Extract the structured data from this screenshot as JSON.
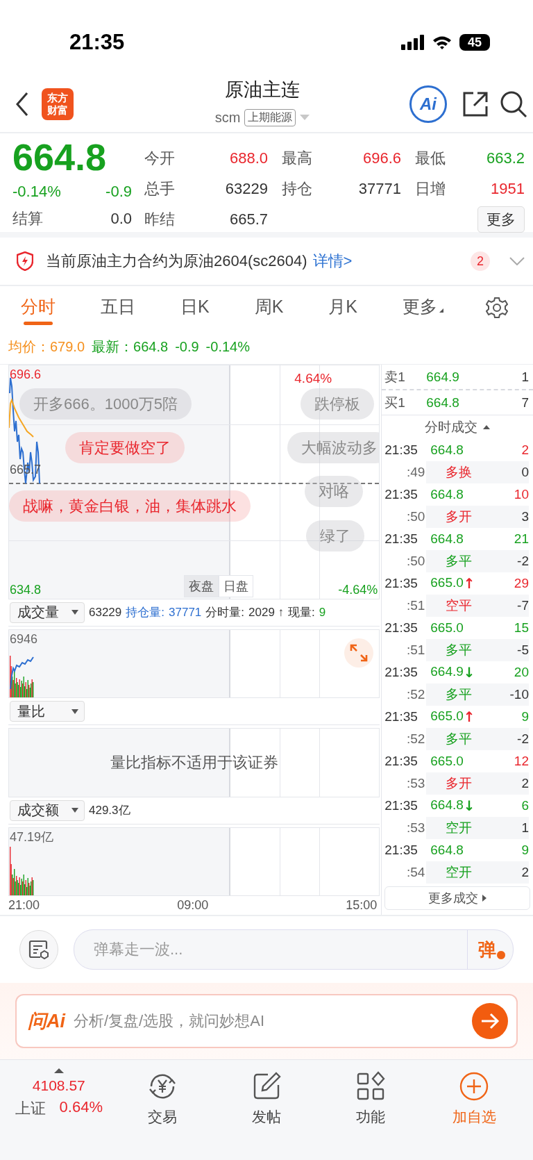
{
  "status_bar": {
    "time": "21:35",
    "battery": "45"
  },
  "header": {
    "logo": [
      "东方",
      "财富"
    ],
    "title": "原油主连",
    "code": "scm",
    "exchange": "上期能源",
    "ai_label": "Ai"
  },
  "quote": {
    "price": "664.8",
    "change_pct": "-0.14%",
    "change": "-0.9",
    "settle_label": "结算",
    "settle_value": "0.0",
    "more_button": "更多",
    "fields": [
      {
        "label": "今开",
        "value": "688.0",
        "color": "#e9262d"
      },
      {
        "label": "最高",
        "value": "696.6",
        "color": "#e9262d"
      },
      {
        "label": "最低",
        "value": "663.2",
        "color": "#17a11f"
      },
      {
        "label": "总手",
        "value": "63229",
        "color": "#333333"
      },
      {
        "label": "持仓",
        "value": "37771",
        "color": "#333333"
      },
      {
        "label": "日增",
        "value": "1951",
        "color": "#e9262d"
      },
      {
        "label": "昨结",
        "value": "665.7",
        "color": "#333333"
      }
    ]
  },
  "notice": {
    "text": "当前原油主力合约为原油2604(sc2604)",
    "link": "详情>",
    "badge": "2"
  },
  "tabs": [
    {
      "label": "分时",
      "selected": true,
      "kind": "tab"
    },
    {
      "label": "五日",
      "selected": false,
      "kind": "tab"
    },
    {
      "label": "日K",
      "selected": false,
      "kind": "tab"
    },
    {
      "label": "周K",
      "selected": false,
      "kind": "tab"
    },
    {
      "label": "月K",
      "selected": false,
      "kind": "tab"
    },
    {
      "label": "更多",
      "selected": false,
      "kind": "menu"
    }
  ],
  "price_summary": {
    "avg_label": "均价：",
    "avg_value": "679.0",
    "last_label": "最新：",
    "last_value": "664.8",
    "change": "-0.9",
    "change_pct": "-0.14%"
  },
  "main_chart": {
    "high": "696.6",
    "high_pct": "4.64%",
    "prev_settle": "665.7",
    "low": "634.8",
    "low_pct": "-4.64%",
    "sessions": [
      {
        "label": "夜盘",
        "selected": true
      },
      {
        "label": "日盘",
        "selected": false
      }
    ],
    "danmaku": [
      {
        "text": "开多666。1000万5陪",
        "kind": "normal"
      },
      {
        "text": "跌停板",
        "kind": "normal"
      },
      {
        "text": "肯定要做空了",
        "kind": "hot"
      },
      {
        "text": "大幅波动多",
        "kind": "normal"
      },
      {
        "text": "战嘛，黄金白银，油，集体跳水",
        "kind": "hot"
      },
      {
        "text": "对咯",
        "kind": "normal"
      },
      {
        "text": "绿了",
        "kind": "normal"
      }
    ]
  },
  "volume_panel": {
    "selector": "成交量",
    "total": "63229",
    "oi_label": "持仓量:",
    "oi_value": "37771",
    "period_label": "分时量:",
    "period_value": "2029 ↑",
    "now_label": "现量:",
    "now_value": "9",
    "axis_max": "6946"
  },
  "ratio_panel": {
    "selector": "量比",
    "message": "量比指标不适用于该证券"
  },
  "amount_panel": {
    "selector": "成交额",
    "total": "429.3亿",
    "axis_max": "47.19亿"
  },
  "time_axis": [
    "21:00",
    "09:00",
    "15:00"
  ],
  "order_book": [
    {
      "label": "卖1",
      "price": "664.9",
      "volume": "1"
    },
    {
      "label": "买1",
      "price": "664.8",
      "volume": "7"
    }
  ],
  "trades_title": "分时成交",
  "trades": [
    {
      "time": "21:35",
      "price": "664.8",
      "volume": {
        "text": "2",
        "color": "#e9262d"
      },
      "second": ":49",
      "type": {
        "text": "多换",
        "color": "#e9262d"
      },
      "change": "0"
    },
    {
      "time": "21:35",
      "price": "664.8",
      "volume": {
        "text": "10",
        "color": "#e9262d"
      },
      "second": ":50",
      "type": {
        "text": "多开",
        "color": "#e9262d"
      },
      "change": "3"
    },
    {
      "time": "21:35",
      "price": "664.8",
      "volume": {
        "text": "21",
        "color": "#17a11f"
      },
      "second": ":50",
      "type": {
        "text": "多平",
        "color": "#17a11f"
      },
      "change": "-2"
    },
    {
      "time": "21:35",
      "price": "665.0",
      "arrow": {
        "text": "↑",
        "color": "#e9262d"
      },
      "volume": {
        "text": "29",
        "color": "#e9262d"
      },
      "second": ":51",
      "type": {
        "text": "空平",
        "color": "#e9262d"
      },
      "change": "-7"
    },
    {
      "time": "21:35",
      "price": "665.0",
      "volume": {
        "text": "15",
        "color": "#17a11f"
      },
      "second": ":51",
      "type": {
        "text": "多平",
        "color": "#17a11f"
      },
      "change": "-5"
    },
    {
      "time": "21:35",
      "price": "664.9",
      "arrow": {
        "text": "↓",
        "color": "#17a11f"
      },
      "volume": {
        "text": "20",
        "color": "#17a11f"
      },
      "second": ":52",
      "type": {
        "text": "多平",
        "color": "#17a11f"
      },
      "change": "-10"
    },
    {
      "time": "21:35",
      "price": "665.0",
      "arrow": {
        "text": "↑",
        "color": "#e9262d"
      },
      "volume": {
        "text": "9",
        "color": "#17a11f"
      },
      "second": ":52",
      "type": {
        "text": "多平",
        "color": "#17a11f"
      },
      "change": "-2"
    },
    {
      "time": "21:35",
      "price": "665.0",
      "volume": {
        "text": "12",
        "color": "#e9262d"
      },
      "second": ":53",
      "type": {
        "text": "多开",
        "color": "#e9262d"
      },
      "change": "2"
    },
    {
      "time": "21:35",
      "price": "664.8",
      "arrow": {
        "text": "↓",
        "color": "#17a11f"
      },
      "volume": {
        "text": "6",
        "color": "#17a11f"
      },
      "second": ":53",
      "type": {
        "text": "空开",
        "color": "#17a11f"
      },
      "change": "1"
    },
    {
      "time": "21:35",
      "price": "664.8",
      "volume": {
        "text": "9",
        "color": "#17a11f"
      },
      "second": ":54",
      "type": {
        "text": "空开",
        "color": "#17a11f"
      },
      "change": "2"
    }
  ],
  "more_trades": "更多成交",
  "danmaku_input": {
    "placeholder": "弹幕走一波...",
    "send": "弹"
  },
  "ai_bar": {
    "logo": "问Ai",
    "placeholder": "分析/复盘/选股，就问妙想AI"
  },
  "bottom_nav": {
    "index": {
      "value": "4108.57",
      "name": "上证",
      "change": "0.64%"
    },
    "items": [
      {
        "label": "交易",
        "kind": "trade"
      },
      {
        "label": "发帖",
        "kind": "post"
      },
      {
        "label": "功能",
        "kind": "apps"
      },
      {
        "label": "加自选",
        "kind": "add"
      }
    ]
  }
}
